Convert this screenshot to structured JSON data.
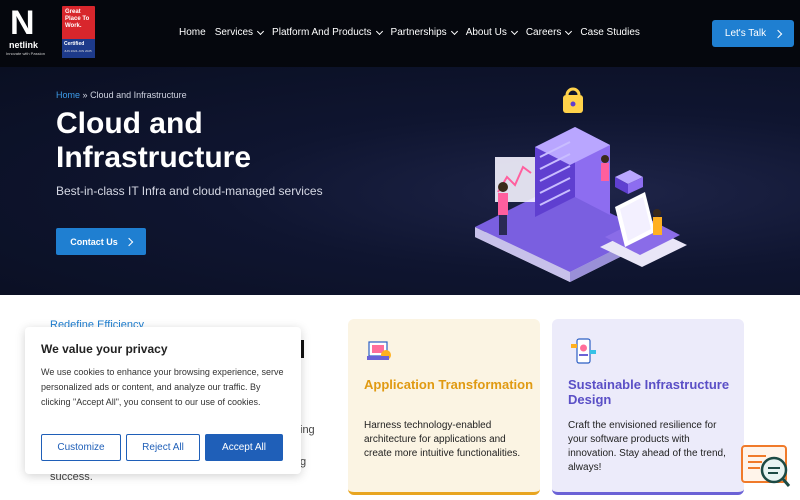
{
  "header": {
    "logo_mark": "N",
    "logo_name": "netlink",
    "logo_tagline": "Innovate with Passion",
    "badge_lines": "Great Place To Work.",
    "badge_cert": "Certified",
    "badge_small": "JUN 2024-JUN 2025",
    "nav": [
      {
        "label": "Home",
        "dropdown": false
      },
      {
        "label": "Services",
        "dropdown": true
      },
      {
        "label": "Platform And Products",
        "dropdown": true
      },
      {
        "label": "Partnerships",
        "dropdown": true
      },
      {
        "label": "About Us",
        "dropdown": true
      },
      {
        "label": "Careers",
        "dropdown": true
      },
      {
        "label": "Case Studies",
        "dropdown": false
      }
    ],
    "cta_label": "Let's Talk"
  },
  "hero": {
    "breadcrumb_home": "Home",
    "breadcrumb_sep": "»",
    "breadcrumb_current": "Cloud and Infrastructure",
    "title": "Cloud and Infrastructure",
    "subtitle": "Best-in-class IT Infra and cloud-managed services",
    "button_label": "Contact Us"
  },
  "content": {
    "eyebrow": "Redefine Efficiency",
    "peek_text_1": "ing",
    "peek_text_2": "g",
    "peek_text_3": "success."
  },
  "cards": [
    {
      "title": "Application Transformation",
      "text": "Harness technology-enabled architecture for applications and create more intuitive functionalities.",
      "icon": "app-transformation-icon"
    },
    {
      "title": "Sustainable Infrastructure Design",
      "text": "Craft the envisioned resilience for your software products with innovation. Stay ahead of the trend, always!",
      "icon": "mobile-design-icon"
    }
  ],
  "cookie": {
    "title": "We value your privacy",
    "text": "We use cookies to enhance your browsing experience, serve personalized ads or content, and analyze our traffic. By clicking \"Accept All\", you consent to our use of cookies.",
    "customize": "Customize",
    "reject": "Reject All",
    "accept": "Accept All"
  },
  "colors": {
    "accent": "#1f7fd1",
    "card1_accent": "#e8a520",
    "card2_accent": "#6b62d6",
    "header_bg": "#05070d"
  }
}
